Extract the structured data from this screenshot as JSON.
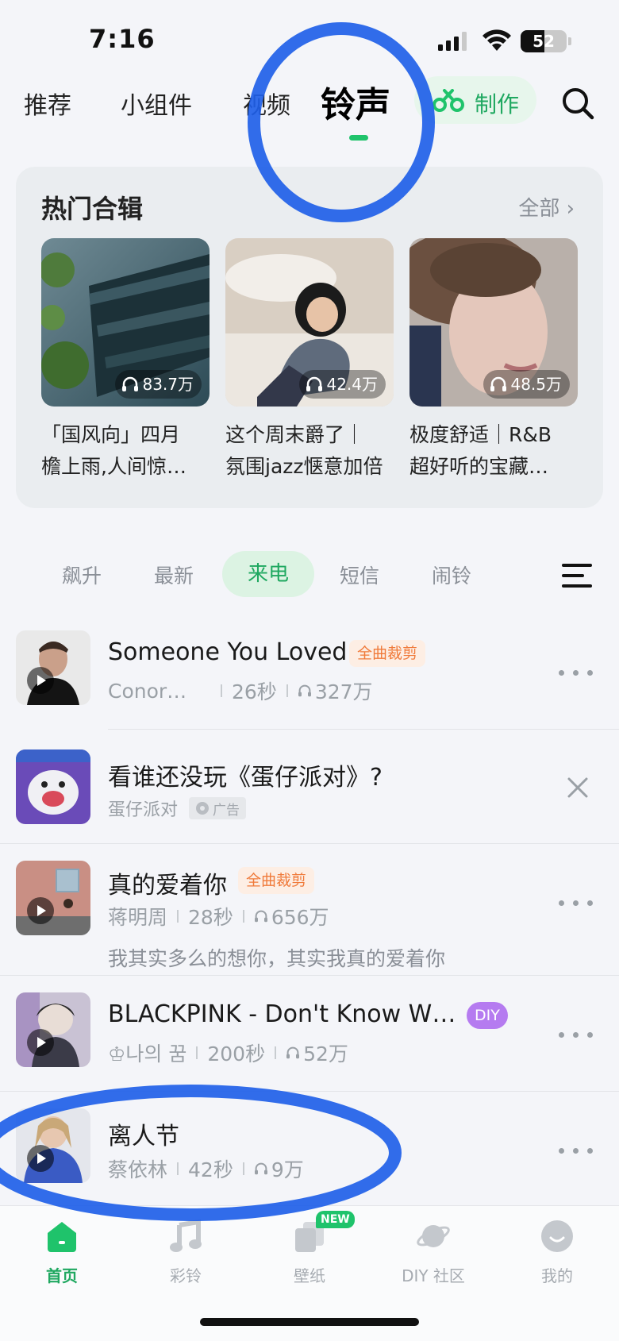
{
  "status_bar": {
    "time": "7:16",
    "battery": "52",
    "battery_level": 0.52
  },
  "top_tabs": {
    "items": [
      "推荐",
      "小组件",
      "视频",
      "铃声"
    ],
    "active": "铃声",
    "make_label": "制作"
  },
  "hot": {
    "title": "热门合辑",
    "all_label": "全部",
    "albums": [
      {
        "plays": "83.7万",
        "title": "「国风向」四月\n檐上雨,人间惊…"
      },
      {
        "plays": "42.4万",
        "title": "这个周末爵了｜\n氛围jazz惬意加倍"
      },
      {
        "plays": "48.5万",
        "title": "极度舒适｜R&B\n超好听的宝藏…"
      }
    ]
  },
  "sub_tabs": {
    "items": [
      "飙升",
      "最新",
      "来电",
      "短信",
      "闹铃"
    ],
    "active": "来电"
  },
  "list": [
    {
      "title": "Someone You Loved",
      "tag": "全曲裁剪",
      "artist": "Conor…",
      "duration": "26秒",
      "plays": "327万"
    },
    {
      "title": "看谁还没玩《蛋仔派对》?",
      "source": "蛋仔派对",
      "ad_label": "广告"
    },
    {
      "title": "真的爱着你",
      "tag": "全曲裁剪",
      "artist": "蒋明周",
      "duration": "28秒",
      "plays": "656万",
      "lyric": "我其实多么的想你，其实我真的爱着你"
    },
    {
      "title": "BLACKPINK - Don't Know W…",
      "tag": "DIY",
      "artist": "♔나의 꿈",
      "duration": "200秒",
      "plays": "52万"
    },
    {
      "title": "离人节",
      "artist": "蔡依林",
      "duration": "42秒",
      "plays": "9万"
    }
  ],
  "bottom_nav": {
    "items": [
      "首页",
      "彩铃",
      "壁纸",
      "DIY 社区",
      "我的"
    ],
    "active": "首页",
    "new_badge": "NEW"
  },
  "colors": {
    "accent": "#1fc36b",
    "tag_orange": "#f07a3a",
    "diy_purple": "#b57bf0",
    "annotation_blue": "#1f5fe8"
  }
}
